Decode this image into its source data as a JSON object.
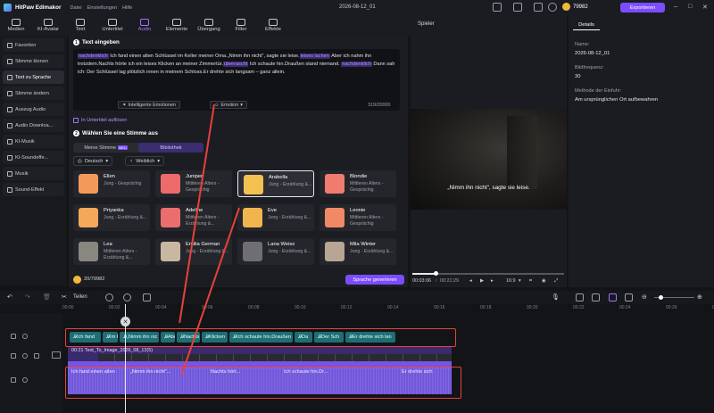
{
  "app": {
    "name": "HitPaw Edimakor",
    "menus": [
      "Datei",
      "Einstellungen",
      "Hilfe"
    ],
    "doc_title": "2026-08-12_01",
    "coins": "79982",
    "export_label": "Exportieren"
  },
  "toolbar": [
    {
      "label": "Medien"
    },
    {
      "label": "KI-Avatar"
    },
    {
      "label": "Text"
    },
    {
      "label": "Untertitel"
    },
    {
      "label": "Audio",
      "active": true
    },
    {
      "label": "Elemente"
    },
    {
      "label": "Übergang"
    },
    {
      "label": "Filter"
    },
    {
      "label": "Effekte"
    }
  ],
  "sidebar": [
    {
      "label": "Favoriten",
      "icon": "star-icon"
    },
    {
      "label": "Stimme klonen",
      "icon": "clone-icon"
    },
    {
      "label": "Text zu Sprache",
      "icon": "text-speech-icon",
      "active": true
    },
    {
      "label": "Stimme ändern",
      "icon": "voice-change-icon"
    },
    {
      "label": "Auszug Audio",
      "icon": "extract-audio-icon"
    },
    {
      "label": "Audio Downloa...",
      "icon": "download-icon"
    },
    {
      "label": "KI-Musik",
      "icon": "music-icon"
    },
    {
      "label": "KI-Soundeffe...",
      "icon": "sound-effect-icon"
    },
    {
      "label": "Musik",
      "icon": "music-note-icon"
    },
    {
      "label": "Sound-Effekt",
      "icon": "sound-icon"
    }
  ],
  "text_section": {
    "number": "1",
    "title": "Text eingeben",
    "segments": [
      {
        "tag": true,
        "text": "nachdenklich"
      },
      {
        "text": " Ich fand einen alten Schlüssel im Keller meiner Oma.„Nimm ihn nicht“, sagte sie leise."
      },
      {
        "tag": true,
        "text": "leises lachen"
      },
      {
        "text": " Aber ich nahm ihn trotzdem.Nachts hörte ich ein leises Klicken an meiner Zimmertür."
      },
      {
        "tag": true,
        "text": "überrascht"
      },
      {
        "text": " Ich schaute hin.Draußen stand niemand. "
      },
      {
        "tag": true,
        "text": "nachdenklich"
      },
      {
        "text": " Dann sah ich: Der Schlüssel lag plötzlich innen in meinem Schloss.Er drehte sich langsam – ganz allein."
      }
    ],
    "smart_emotions": "Intelligente Emotionen",
    "emotion_label": "Emotion",
    "counter": "319/20000",
    "subtitle_checkbox": "In Untertitel auflösen"
  },
  "voice_section": {
    "number": "2",
    "title": "Wählen Sie eine Stimme aus",
    "tabs": [
      {
        "label": "Meine Stimme",
        "badge": "NEU"
      },
      {
        "label": "Bibliothek",
        "active": true
      }
    ],
    "language": "Deutsch",
    "gender": "Weiblich",
    "voices": [
      {
        "name": "Ellen",
        "desc": "Jung - Gesprächig",
        "color": "#f39a5a"
      },
      {
        "name": "Juniper",
        "desc": "Mittleren Alters - Gesprächig",
        "color": "#ee6b6b"
      },
      {
        "name": "Arabella",
        "desc": "Jung - Erzählung &...",
        "color": "#f3c052",
        "selected": true
      },
      {
        "name": "Blondie",
        "desc": "Mittleren Alters - Gesprächig",
        "color": "#ef7c6e"
      },
      {
        "name": "Priyanka",
        "desc": "Jung - Erzählung &...",
        "color": "#f3a85a"
      },
      {
        "name": "Adeline",
        "desc": "Mittleren Alters - Erzählung &...",
        "color": "#ec6d6d"
      },
      {
        "name": "Eve",
        "desc": "Jung - Erzählung &...",
        "color": "#f0b54e"
      },
      {
        "name": "Leonie",
        "desc": "Mittleren Alters - Gesprächig",
        "color": "#f08a66"
      },
      {
        "name": "Lea",
        "desc": "Mittleren Alters - Erzählung &...",
        "color": "#8a8680"
      },
      {
        "name": "Emilia German",
        "desc": "Jung - Erzählung &...",
        "color": "#c9b7a2"
      },
      {
        "name": "Lana Weiss",
        "desc": "Jung - Erzählung &...",
        "color": "#6e6e74"
      },
      {
        "name": "Mila Winter",
        "desc": "Jung - Erzählung &...",
        "color": "#b8a593"
      }
    ],
    "cost": "20/79982",
    "generate_label": "Sprache generieren"
  },
  "player": {
    "title": "Spieler",
    "subtitle": "„Nimm ihn nicht“, sagte sie leise.",
    "time_current": "00:03:06",
    "time_total": "00:21:29",
    "aspect": "16:9",
    "progress": 0.15
  },
  "details": {
    "tab": "Details",
    "fields": [
      {
        "label": "Name:",
        "value": "2026-08-12_01"
      },
      {
        "label": "Bildfrequenz:",
        "value": "30"
      },
      {
        "label": "Methode der Einfuhr:",
        "value": "Am ursprünglichen Ort aufbewahren"
      }
    ]
  },
  "timeline": {
    "split_label": "Teilen",
    "ruler": [
      "00:00",
      "00:02",
      "00:04",
      "00:06",
      "00:08",
      "00:10",
      "00:12",
      "00:14",
      "00:16",
      "00:18",
      "00:20",
      "00:22",
      "00:24",
      "00:26",
      "00:28"
    ],
    "text_segments": [
      "Ich fand",
      "Im K",
      "„Nimm ihn nic",
      "Aber",
      "Nachts",
      "Klicken",
      "Ich schaute hin.Draußen",
      "Da",
      "Der Sch",
      "Er drehte sich lan"
    ],
    "video_clip": "00:21 Text_To_Image_2026_08_12(5)",
    "audio_text": [
      "Ich fand einen alten",
      "„Nimm ihn nicht“...",
      "Nachts hört...",
      "Ich schaute hin.Dr...",
      "Er drehte sich"
    ]
  }
}
